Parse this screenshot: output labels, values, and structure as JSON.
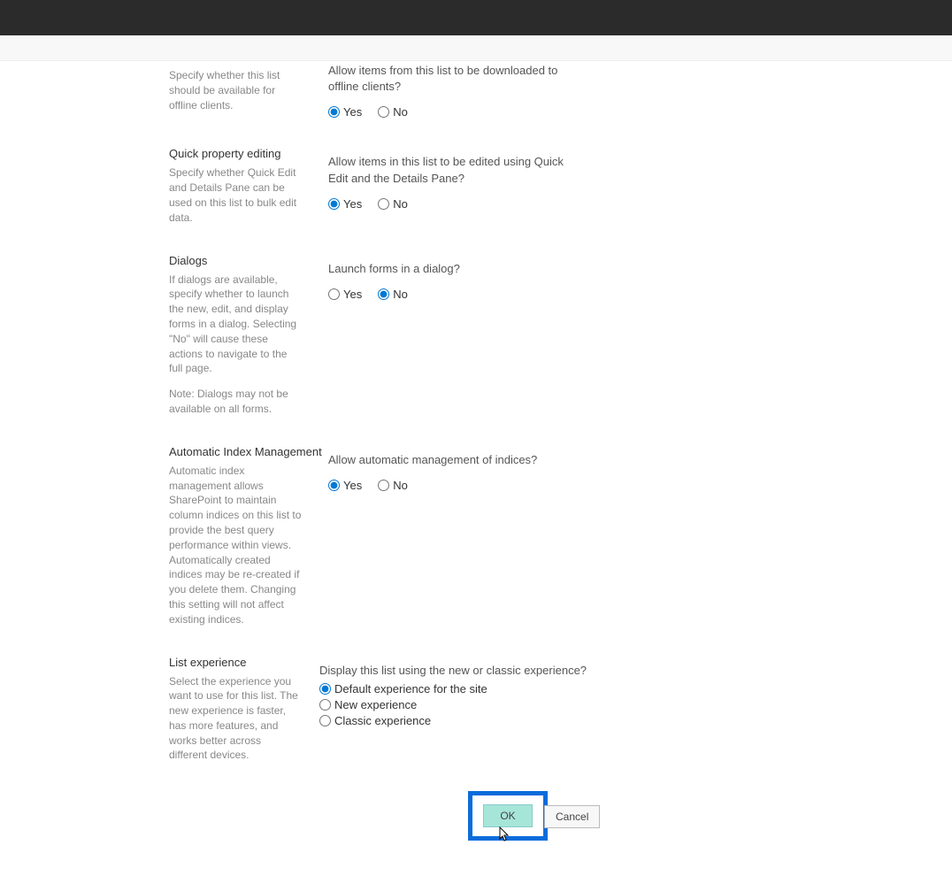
{
  "offline": {
    "desc": "Specify whether this list should be available for offline clients.",
    "question": "Allow items from this list to be downloaded to offline clients?",
    "yes": "Yes",
    "no": "No"
  },
  "quickedit": {
    "title": "Quick property editing",
    "desc": "Specify whether Quick Edit and Details Pane can be used on this list to bulk edit data.",
    "question": "Allow items in this list to be edited using Quick Edit and the Details Pane?",
    "yes": "Yes",
    "no": "No"
  },
  "dialogs": {
    "title": "Dialogs",
    "desc": "If dialogs are available, specify whether to launch the new, edit, and display forms in a dialog. Selecting \"No\" will cause these actions to navigate to the full page.",
    "note": "Note: Dialogs may not be available on all forms.",
    "question": "Launch forms in a dialog?",
    "yes": "Yes",
    "no": "No"
  },
  "autoindex": {
    "title": "Automatic Index Management",
    "desc": "Automatic index management allows SharePoint to maintain column indices on this list to provide the best query performance within views. Automatically created indices may be re-created if you delete them. Changing this setting will not affect existing indices.",
    "question": "Allow automatic management of indices?",
    "yes": "Yes",
    "no": "No"
  },
  "listexp": {
    "title": "List experience",
    "desc": "Select the experience you want to use for this list. The new experience is faster, has more features, and works better across different devices.",
    "question": "Display this list using the new or classic experience?",
    "opt_default": "Default experience for the site",
    "opt_new": "New experience",
    "opt_classic": "Classic experience"
  },
  "buttons": {
    "ok": "OK",
    "cancel": "Cancel"
  }
}
